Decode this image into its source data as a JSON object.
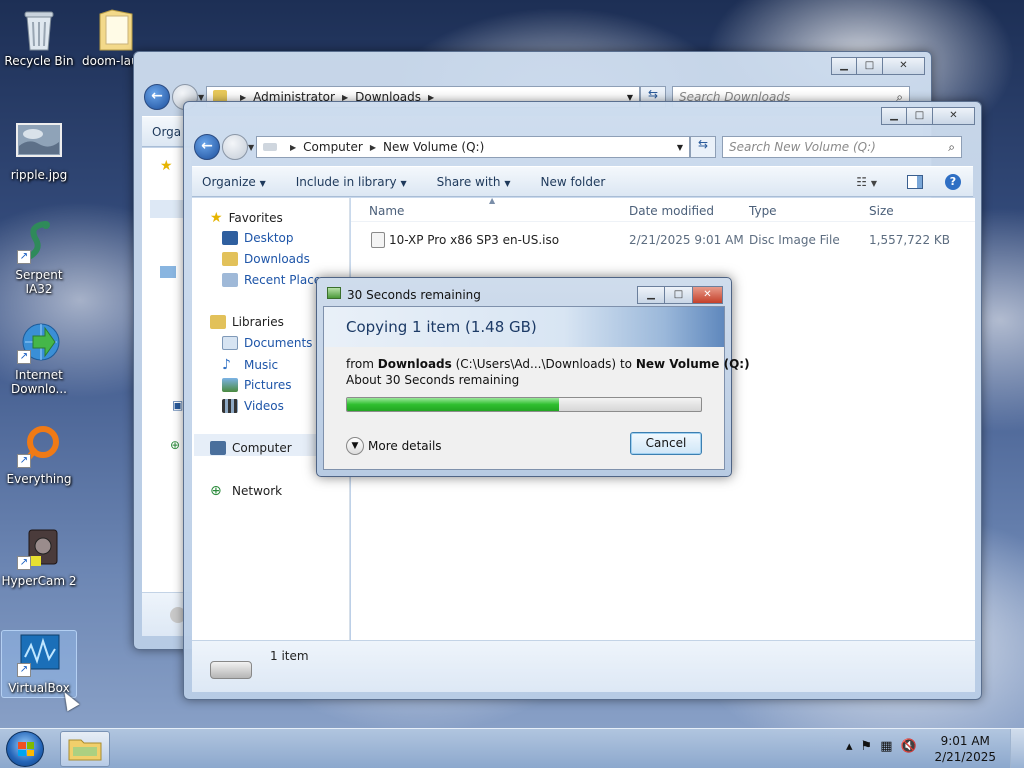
{
  "desktop": {
    "icons": [
      {
        "label": "Recycle Bin"
      },
      {
        "label": "doom-lau"
      },
      {
        "label": "ripple.jpg"
      },
      {
        "label": "Serpent IA32"
      },
      {
        "label": "Internet Downlo..."
      },
      {
        "label": "Everything"
      },
      {
        "label": "HyperCam 2"
      },
      {
        "label": "VirtualBox"
      }
    ]
  },
  "back_window": {
    "breadcrumb": [
      "Administrator",
      "Downloads"
    ],
    "search_placeholder": "Search Downloads",
    "toolbar_partial": "Orga"
  },
  "front_window": {
    "breadcrumb": [
      "Computer",
      "New Volume (Q:)"
    ],
    "search_placeholder": "Search New Volume (Q:)",
    "toolbar": [
      "Organize",
      "Include in library",
      "Share with",
      "New folder"
    ],
    "nav": {
      "favorites": "Favorites",
      "favorites_items": [
        "Desktop",
        "Downloads",
        "Recent Places"
      ],
      "libraries": "Libraries",
      "libraries_items": [
        "Documents",
        "Music",
        "Pictures",
        "Videos"
      ],
      "computer": "Computer",
      "network": "Network"
    },
    "columns": [
      "Name",
      "Date modified",
      "Type",
      "Size"
    ],
    "files": [
      {
        "name": "10-XP Pro x86 SP3 en-US.iso",
        "date": "2/21/2025 9:01 AM",
        "type": "Disc Image File",
        "size": "1,557,722 KB"
      }
    ],
    "status": "1 item"
  },
  "copy_dialog": {
    "title": "30 Seconds remaining",
    "heading": "Copying 1 item (1.48 GB)",
    "from_word": "from",
    "from_name": "Downloads",
    "from_path": "(C:\\Users\\Ad...\\Downloads)",
    "to_word": "to",
    "to_name": "New Volume (Q:)",
    "remaining": "About 30 Seconds remaining",
    "progress_fraction": 0.6,
    "more_details": "More details",
    "cancel": "Cancel"
  },
  "taskbar": {
    "time": "9:01 AM",
    "date": "2/21/2025"
  }
}
